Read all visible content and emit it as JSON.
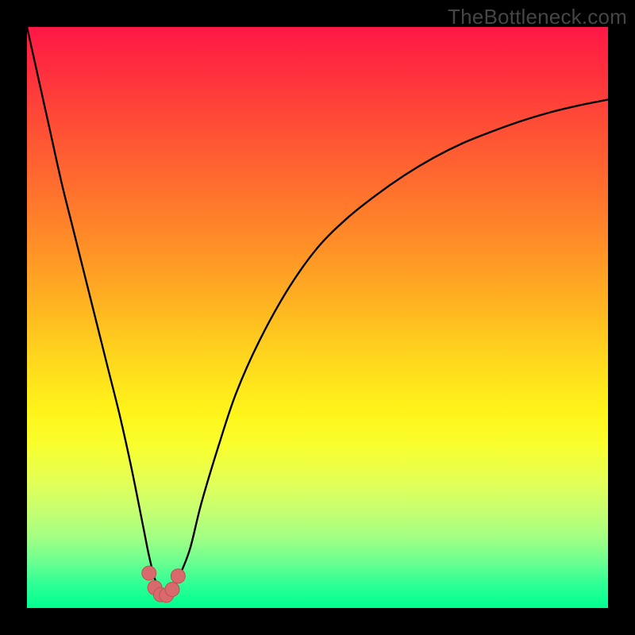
{
  "watermark": "TheBottleneck.com",
  "colors": {
    "frame": "#000000",
    "curve_stroke": "#000000",
    "knot_fill": "#d86a6e",
    "knot_stroke": "#c05055"
  },
  "chart_data": {
    "type": "line",
    "title": "",
    "xlabel": "",
    "ylabel": "",
    "xlim": [
      0,
      100
    ],
    "ylim": [
      0,
      100
    ],
    "grid": false,
    "note": "No axes, ticks, or labels are rendered. Values are read off by scaling the visible curve to the plot's full width (x:0–100) and full height (y:0–100, with 100 at top / y=0 at bottom baseline).",
    "series": [
      {
        "name": "curve",
        "x": [
          0,
          2,
          4,
          6,
          8,
          10,
          12,
          14,
          16,
          18,
          20,
          21,
          22,
          23,
          24,
          25,
          26,
          28,
          30,
          33,
          36,
          40,
          45,
          50,
          55,
          60,
          65,
          70,
          75,
          80,
          85,
          90,
          95,
          100
        ],
        "y": [
          100,
          91,
          82,
          73,
          65,
          57,
          49,
          41,
          33,
          24,
          14,
          9,
          5,
          3,
          2.5,
          3,
          5,
          10,
          18,
          28,
          37,
          46,
          55,
          62,
          67,
          71,
          74.5,
          77.5,
          80,
          82,
          83.8,
          85.3,
          86.5,
          87.5
        ]
      }
    ],
    "markers": {
      "name": "trough-knots",
      "note": "Small rounded markers clustered at the curve minimum (approx x≈21–26).",
      "points": [
        {
          "x": 21.0,
          "y": 6.0
        },
        {
          "x": 22.0,
          "y": 3.5
        },
        {
          "x": 23.0,
          "y": 2.3
        },
        {
          "x": 24.0,
          "y": 2.2
        },
        {
          "x": 25.0,
          "y": 3.2
        },
        {
          "x": 26.0,
          "y": 5.5
        }
      ]
    }
  }
}
